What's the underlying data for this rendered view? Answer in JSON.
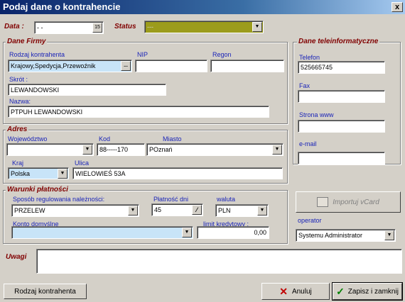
{
  "window": {
    "title": "Podaj dane o kontrahencie",
    "close_glyph": "x"
  },
  "top": {
    "data_label": "Data :",
    "data_value": "- -",
    "calendar_glyph": "15",
    "status_label": "Status",
    "status_value": "---"
  },
  "firma": {
    "legend": "Dane Firmy",
    "rodzaj_label": "Rodzaj kontrahenta",
    "rodzaj_value": "Krajowy,Spedycja,Przewoźnik",
    "rodzaj_btn": "...",
    "nip_label": "NIP",
    "nip_value": "",
    "regon_label": "Regon",
    "regon_value": "",
    "skrot_label": "Skrót :",
    "skrot_value": "LEWANDOWSKI",
    "nazwa_label": "Nazwa:",
    "nazwa_value": "PTPUH  LEWANDOWSKI"
  },
  "adres": {
    "legend": "Adres",
    "woj_label": "Województwo",
    "woj_value": "",
    "kod_label": "Kod",
    "kod_value": "88-----170",
    "miasto_label": "Miasto",
    "miasto_value": "POznań",
    "kraj_label": "Kraj",
    "kraj_value": "Polska",
    "ulica_label": "Ulica",
    "ulica_value": "WIELOWIEŚ 53A"
  },
  "platnosci": {
    "legend": "Warunki płatności",
    "sposob_label": "Sposób regulowania należności:",
    "sposob_value": "PRZELEW",
    "platnosc_label": "Płatność dni",
    "platnosc_value": "45",
    "waluta_label": "waluta",
    "waluta_value": "PLN",
    "konto_label": "Konto domyślne",
    "konto_value": "",
    "limit_label": "limit kredytowy :",
    "limit_value": "0,00"
  },
  "tele": {
    "legend": "Dane teleinformatyczne",
    "telefon_label": "Telefon",
    "telefon_value": "525665745",
    "fax_label": "Fax",
    "fax_value": "",
    "www_label": "Strona www",
    "www_value": "",
    "email_label": "e-mail",
    "email_value": ""
  },
  "side": {
    "importuj_label": "Importuj vCard",
    "operator_label": "operator",
    "operator_value": "Systemu Administrator"
  },
  "uwagi": {
    "label": "Uwagi",
    "value": ""
  },
  "footer": {
    "rodzaj_btn": "Rodzaj kontrahenta",
    "anuluj_btn": "Anuluj",
    "zapisz_btn": "Zapisz i zamknij"
  },
  "colors": {
    "accent_title": "#0a246a",
    "status_field": "#9c9c1c",
    "lookup_field": "#c8e4f8",
    "label_blue": "#1a24b8",
    "label_maroon": "#800000"
  }
}
